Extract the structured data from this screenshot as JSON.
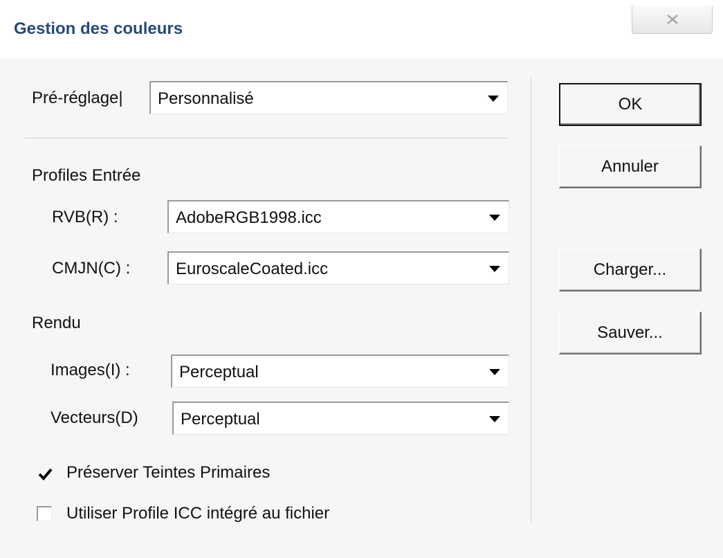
{
  "dialog": {
    "title": "Gestion des couleurs"
  },
  "preset": {
    "label": "Pré-réglage|",
    "value": "Personnalisé"
  },
  "input_profiles": {
    "heading": "Profiles Entrée",
    "rgb": {
      "label": "RVB(R) :",
      "value": "AdobeRGB1998.icc"
    },
    "cmyk": {
      "label": "CMJN(C) :",
      "value": "EuroscaleCoated.icc"
    }
  },
  "rendering": {
    "heading": "Rendu",
    "images": {
      "label": "Images(I) :",
      "value": "Perceptual"
    },
    "vectors": {
      "label": "Vecteurs(D)",
      "value": "Perceptual"
    }
  },
  "options": {
    "preserve_primaries": {
      "label": "Préserver Teintes Primaires",
      "checked": true
    },
    "use_embedded_icc": {
      "label": "Utiliser Profile ICC intégré au fichier",
      "checked": false
    }
  },
  "buttons": {
    "ok": "OK",
    "cancel": "Annuler",
    "load": "Charger...",
    "save": "Sauver..."
  },
  "icons": {
    "close": "close-icon",
    "dropdown": "chevron-down-icon",
    "check": "checkmark-icon"
  },
  "colors": {
    "title": "#274a78",
    "background": "#f6f6f5"
  }
}
